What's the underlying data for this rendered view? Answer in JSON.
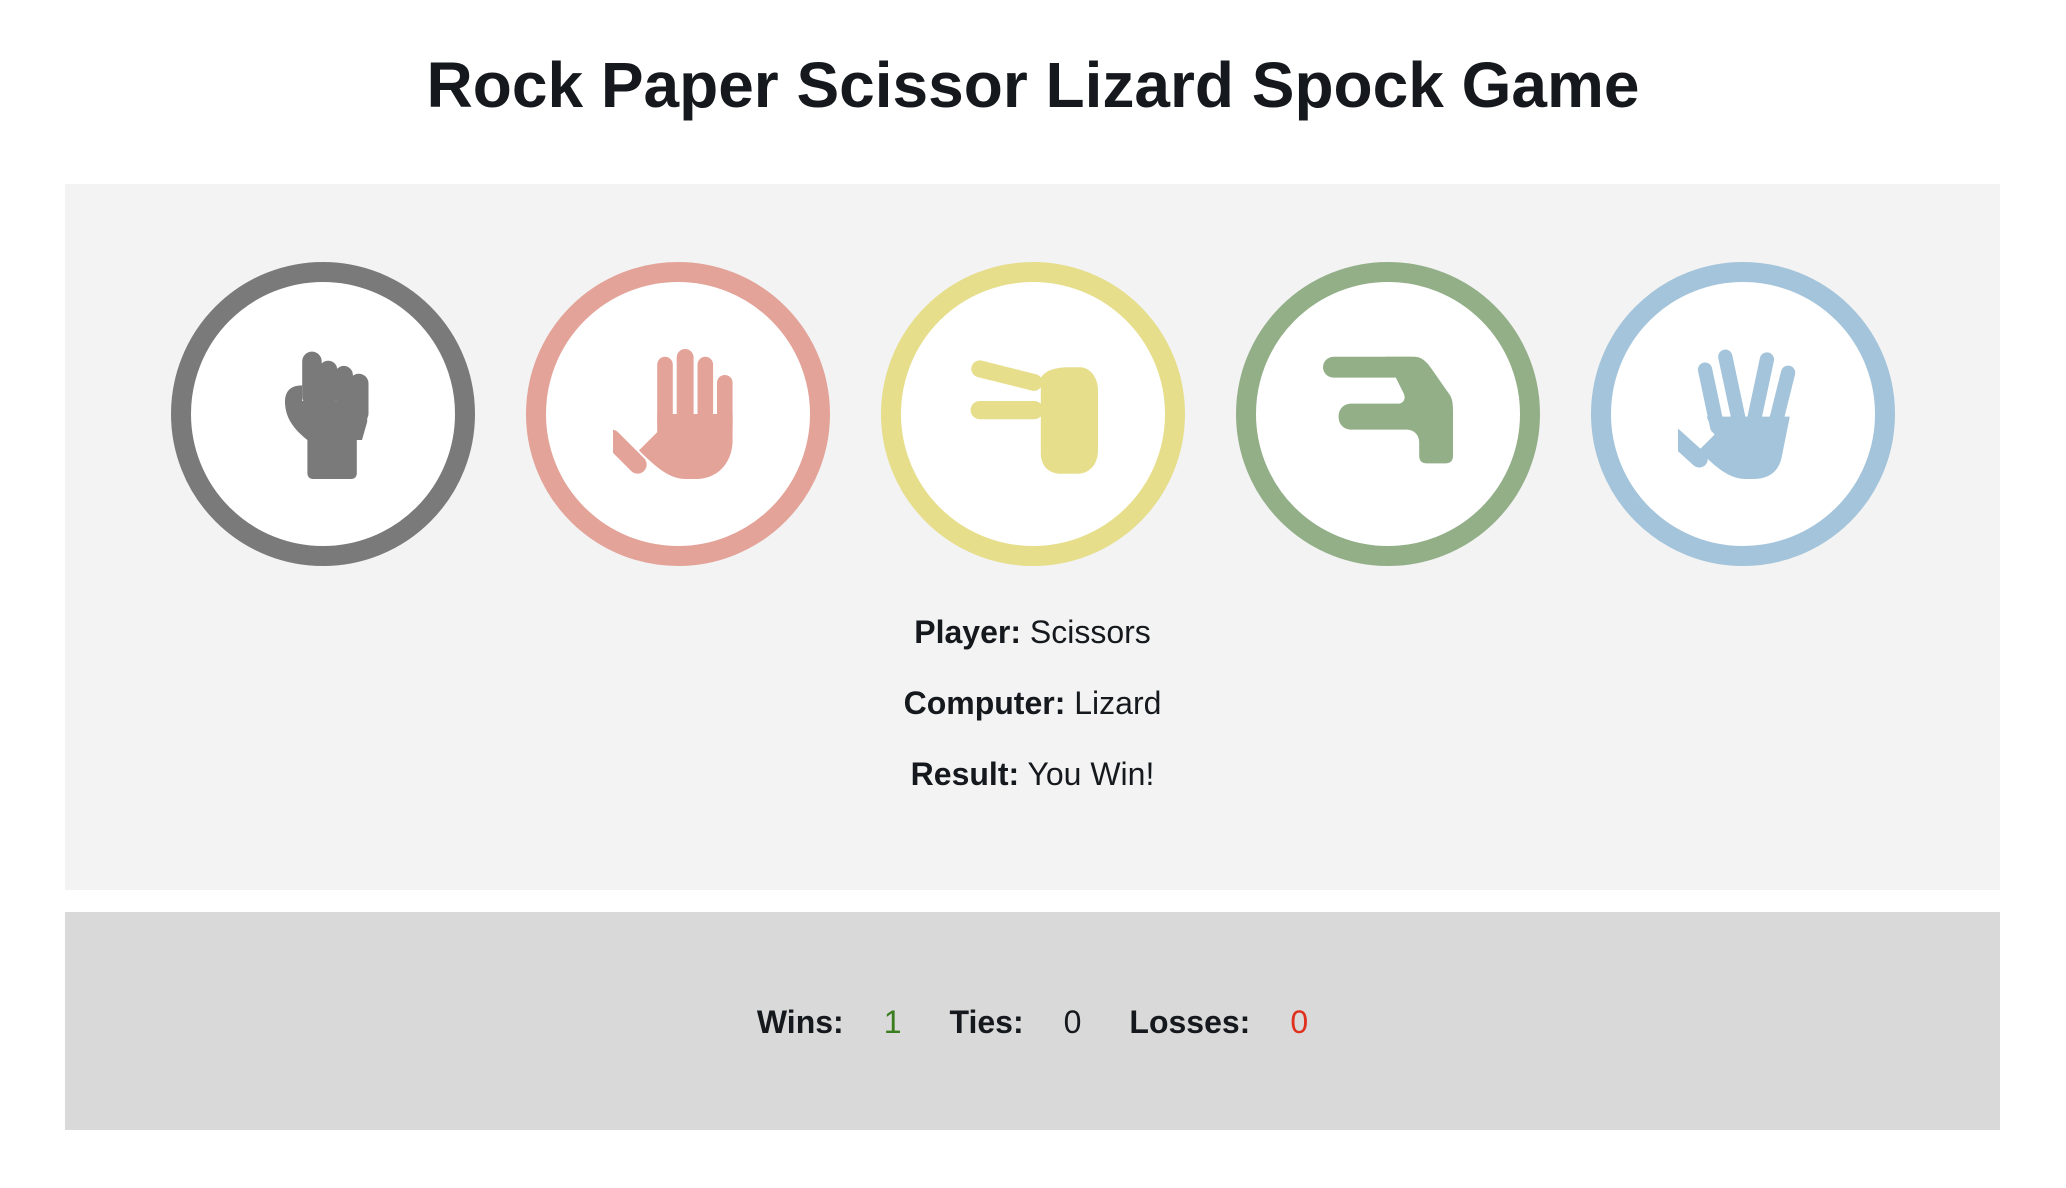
{
  "title": "Rock Paper Scissor Lizard Spock Game",
  "choices": [
    {
      "name": "Rock",
      "icon": "hand-rock-icon",
      "color": "#7a7a7a"
    },
    {
      "name": "Paper",
      "icon": "hand-paper-icon",
      "color": "#e3a398"
    },
    {
      "name": "Scissors",
      "icon": "hand-scissors-icon",
      "color": "#e6de8b"
    },
    {
      "name": "Lizard",
      "icon": "hand-lizard-icon",
      "color": "#93af88"
    },
    {
      "name": "Spock",
      "icon": "hand-spock-icon",
      "color": "#a3c4da"
    }
  ],
  "result": {
    "player_label": "Player:",
    "player_value": "Scissors",
    "computer_label": "Computer:",
    "computer_value": "Lizard",
    "result_label": "Result:",
    "result_value": "You Win!"
  },
  "scoreboard": {
    "wins_label": "Wins:",
    "wins_value": "1",
    "wins_color": "#3a7d1e",
    "ties_label": "Ties:",
    "ties_value": "0",
    "losses_label": "Losses:",
    "losses_value": "0",
    "losses_color": "#e0301e"
  }
}
